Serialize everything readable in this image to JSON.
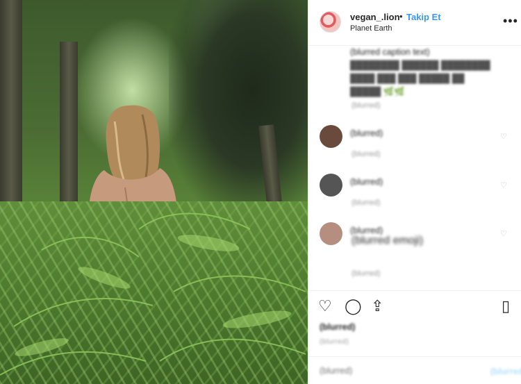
{
  "post": {
    "image_alt": "Woman walking through a forest of ferns",
    "author": {
      "username": "vegan_.lion",
      "location": "Planet Earth",
      "follow_label": "Takip Et",
      "separator": "•"
    },
    "caption": {
      "text": "(blurred caption text)",
      "time": "(blurred)",
      "likes": "(blurred)",
      "reply": "(blurred)"
    },
    "comments": [
      {
        "username": "(blurred)",
        "text": "",
        "time": "(blurred)",
        "reply": "(blurred)",
        "avatar_color": "#6b4a3e"
      },
      {
        "username": "(blurred)",
        "text": "",
        "time": "(blurred)",
        "reply": "(blurred)",
        "avatar_color": "#555555"
      },
      {
        "username": "(blurred)",
        "text": "(blurred emoji)",
        "time": "(blurred)",
        "likes": "(blurred)",
        "reply": "(blurred)",
        "avatar_color": "#b58e80"
      }
    ],
    "likes_count": "(blurred)",
    "date": "(blurred)",
    "comment_placeholder": "(blurred)",
    "post_label": "(blurred)"
  },
  "icons": {
    "more": "more-options-icon",
    "like": "heart-icon",
    "comment": "comment-icon",
    "share": "share-icon",
    "save": "bookmark-icon"
  },
  "colors": {
    "follow": "#3897f0",
    "muted": "#999999",
    "border": "#efefef"
  }
}
